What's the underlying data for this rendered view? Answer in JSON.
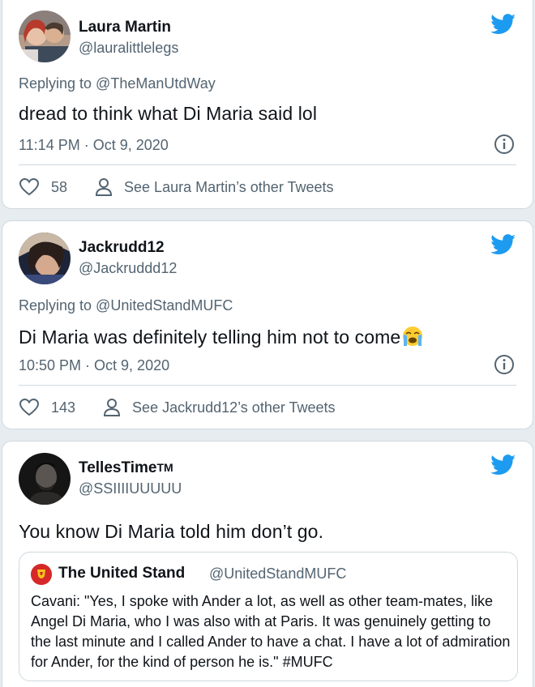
{
  "colors": {
    "twitter_blue": "#1d9bf0",
    "text_primary": "#0f1419",
    "text_secondary": "#536471",
    "border": "#cfd9de",
    "background": "#e6ecf0"
  },
  "tweets": [
    {
      "name": "Laura Martin",
      "handle": "@lauralittlelegs",
      "replying_to": "Replying to @TheManUtdWay",
      "text": "dread to think what Di Maria said lol",
      "timestamp": "11:14 PM · Oct 9, 2020",
      "likes": "58",
      "other_tweets": "See Laura Martin’s other Tweets",
      "icons": [
        "twitter-bird-icon",
        "info-icon",
        "heart-icon",
        "person-icon"
      ]
    },
    {
      "name": "Jackrudd12",
      "handle": "@Jackruddd12",
      "replying_to": "Replying to @UnitedStandMUFC",
      "text": "Di Maria was definitely telling him not to come",
      "emoji": "loudly-crying-face-emoji",
      "timestamp": "10:50 PM · Oct 9, 2020",
      "likes": "143",
      "other_tweets": "See Jackrudd12’s other Tweets",
      "icons": [
        "twitter-bird-icon",
        "info-icon",
        "heart-icon",
        "person-icon"
      ]
    },
    {
      "name": "TellesTime",
      "name_suffix": "TM",
      "handle": "@SSIIIIUUUUU",
      "text": "You know Di Maria told him don’t go.",
      "quote": {
        "name": "The United Stand",
        "handle": "@UnitedStandMUFC",
        "text": "Cavani: \"Yes, I spoke with Ander a lot, as well as other team-mates, like Angel Di Maria, who I was also with at Paris. It was genuinely getting to the last minute and I called Ander to have a chat. I have a lot of admiration for Ander, for the kind of person he is.\" #MUFC"
      },
      "icons": [
        "twitter-bird-icon"
      ]
    }
  ]
}
